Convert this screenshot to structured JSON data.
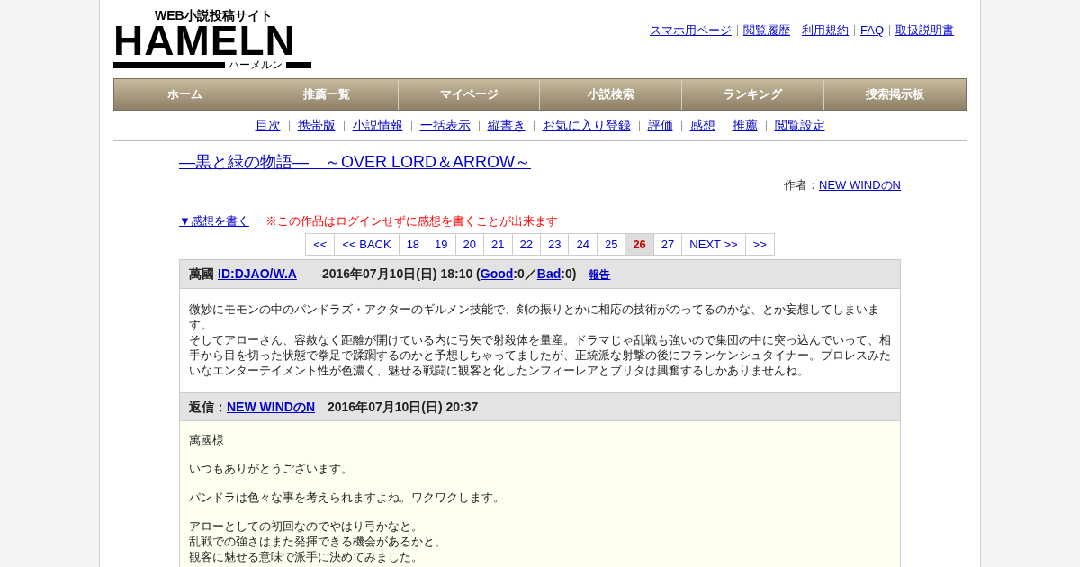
{
  "logo": {
    "tagline": "WEB小説投稿サイト",
    "wordmark": "HAMELN",
    "kana": "ハーメルン"
  },
  "top_links": [
    "スマホ用ページ",
    "閲覧履歴",
    "利用規約",
    "FAQ",
    "取扱説明書"
  ],
  "main_nav": [
    "ホーム",
    "推薦一覧",
    "マイページ",
    "小説検索",
    "ランキング",
    "捜索掲示板"
  ],
  "sub_nav": [
    "目次",
    "携帯版",
    "小説情報",
    "一括表示",
    "縦書き",
    "お気に入り登録",
    "評価",
    "感想",
    "推薦",
    "閲覧設定"
  ],
  "novel": {
    "title": "―黒と緑の物語―　～OVER LORD＆ARROW～",
    "author_label": "作者：",
    "author": "NEW WINDのN"
  },
  "write_link": "▼感想を書く",
  "notice": "※この作品はログインせずに感想を書くことが出来ます",
  "pager": [
    {
      "label": "<<",
      "selected": false
    },
    {
      "label": "<< BACK",
      "selected": false
    },
    {
      "label": "18",
      "selected": false
    },
    {
      "label": "19",
      "selected": false
    },
    {
      "label": "20",
      "selected": false
    },
    {
      "label": "21",
      "selected": false
    },
    {
      "label": "22",
      "selected": false
    },
    {
      "label": "23",
      "selected": false
    },
    {
      "label": "24",
      "selected": false
    },
    {
      "label": "25",
      "selected": false
    },
    {
      "label": "26",
      "selected": true
    },
    {
      "label": "27",
      "selected": false
    },
    {
      "label": "NEXT >>",
      "selected": false
    },
    {
      "label": ">>",
      "selected": false
    }
  ],
  "comment": {
    "name": "萬國",
    "id": "ID:DJAO/W.A",
    "date": "2016年07月10日(日) 18:10 (",
    "good": "Good",
    "good_count": ":0／",
    "bad": "Bad",
    "bad_count": ":0)",
    "report": "報告",
    "lines": [
      "微妙にモモンの中のパンドラズ・アクターのギルメン技能で、剣の振りとかに相応の技術がのってるのかな、とか妄想してしまいます。",
      "そしてアローさん、容赦なく距離が開けている内に弓矢で射殺体を量産。ドラマじゃ乱戦も強いので集団の中に突っ込んでいって、相手から目を切った状態で拳足で蹂躙するのかと予想しちゃってましたが、正統派な射撃の後にフランケンシュタイナー。プロレスみたいなエンターテイメント性が色濃く、魅せる戦闘に観客と化したンフィーレアとブリタは興奮するしかありませんね。"
    ]
  },
  "reply": {
    "label": "返信：",
    "author": "NEW WINDのN",
    "date": "2016年07月10日(日) 20:37",
    "paragraphs": [
      [
        "萬國様"
      ],
      [
        "いつもありがとうございます。"
      ],
      [
        "パンドラは色々な事を考えられますよね。ワクワクします。"
      ],
      [
        "アローとしての初回なのでやはり弓かなと。",
        "乱戦での強さはまた発揮できる機会があるかと。",
        "観客に魅せる意味で派手に決めてみました。"
      ]
    ]
  }
}
